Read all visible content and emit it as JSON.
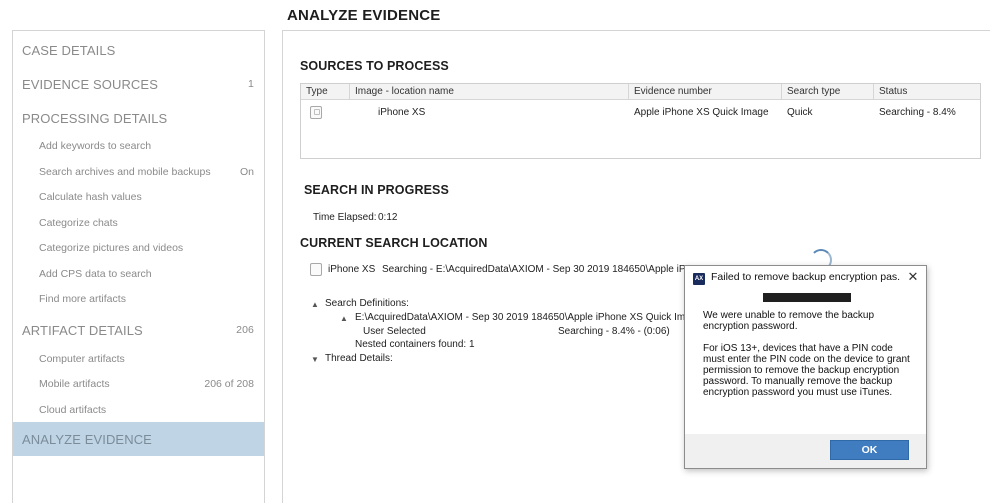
{
  "page": {
    "title": "ANALYZE EVIDENCE"
  },
  "sidebar": {
    "sections": [
      {
        "label": "CASE DETAILS",
        "count": ""
      },
      {
        "label": "EVIDENCE SOURCES",
        "count": "1"
      },
      {
        "label": "PROCESSING DETAILS",
        "count": ""
      },
      {
        "label": "ARTIFACT DETAILS",
        "count": "206"
      },
      {
        "label": "ANALYZE EVIDENCE",
        "count": ""
      }
    ],
    "processing_items": [
      {
        "label": "Add keywords to search",
        "value": ""
      },
      {
        "label": "Search archives and mobile backups",
        "value": "On"
      },
      {
        "label": "Calculate hash values",
        "value": ""
      },
      {
        "label": "Categorize chats",
        "value": ""
      },
      {
        "label": "Categorize pictures and videos",
        "value": ""
      },
      {
        "label": "Add CPS data to search",
        "value": ""
      },
      {
        "label": "Find more artifacts",
        "value": ""
      }
    ],
    "artifact_items": [
      {
        "label": "Computer artifacts",
        "value": ""
      },
      {
        "label": "Mobile artifacts",
        "value": "206 of 208"
      },
      {
        "label": "Cloud artifacts",
        "value": ""
      }
    ]
  },
  "sources": {
    "title": "SOURCES TO PROCESS",
    "columns": [
      "Type",
      "Image - location name",
      "Evidence number",
      "Search type",
      "Status"
    ],
    "rows": [
      {
        "type_icon": "phone-image-icon",
        "name": "iPhone XS",
        "evidence_number": "Apple iPhone XS Quick Image",
        "search_type": "Quick",
        "status": "Searching - 8.4%"
      }
    ]
  },
  "progress": {
    "title": "SEARCH IN PROGRESS",
    "elapsed_label": "Time Elapsed:",
    "elapsed_value": "0:12"
  },
  "location": {
    "title": "CURRENT SEARCH LOCATION",
    "device": "iPhone XS",
    "path": "Searching - E:\\AcquiredData\\AXIOM - Sep 30 2019 184650\\Apple iP",
    "search_definitions_label": "Search Definitions:",
    "definition_path": "E:\\AcquiredData\\AXIOM - Sep 30 2019 184650\\Apple iPhone XS Quick Im",
    "user_selected_label": "User Selected",
    "user_selected_status": "Searching - 8.4% - (0:06)",
    "nested_containers": "Nested containers found: 1",
    "thread_details_label": "Thread Details:"
  },
  "dialog": {
    "title": "Failed to remove backup encryption pas...",
    "app_icon": "axiom-app-icon",
    "message1": "We were unable to remove the backup encryption password.",
    "message2": "For iOS 13+, devices that have a PIN code must enter the PIN code on the device to grant permission to remove the backup encryption password. To manually remove the backup encryption password you must use iTunes.",
    "ok_label": "OK"
  },
  "colors": {
    "active_nav_bg": "#bfd5e6",
    "ok_button": "#3f7cc0",
    "muted_text": "#8a8a8a"
  }
}
